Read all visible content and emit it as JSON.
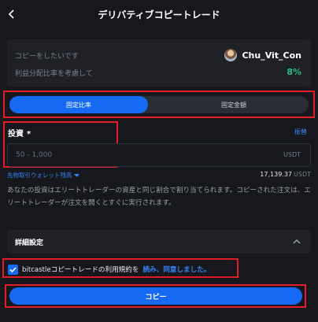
{
  "header": {
    "title": "デリバティブコピートレード",
    "back_icon": "chevron-left-icon"
  },
  "summary": {
    "copy_label": "コピーをしたいです",
    "trader_name": "Chu_Vit_Con",
    "profit_share_label": "利益分配比率を考慮して",
    "profit_share_value": "8%"
  },
  "mode": {
    "ratio_label": "固定比率",
    "amount_label": "固定金額",
    "selected": "ratio"
  },
  "investment": {
    "label": "投資",
    "required_mark": "*",
    "fixed_link": "振替",
    "placeholder": "50 - 1,000",
    "unit": "USDT",
    "wallet_label": "先物取引ウォレット残高",
    "wallet_balance": "17,139.37",
    "wallet_unit": "USDT"
  },
  "description": "あなたの投資はエリートトレーダーの資産と同じ割合で割り当てられます。コピーされた注文は、エリートトレーダーが注文を開くとすぐに実行されます。",
  "advanced": {
    "label": "詳細設定",
    "expanded": true
  },
  "agreement": {
    "checked": true,
    "text": "bitcastleコピートレードの利用規約を",
    "link": "読み、同意しました。"
  },
  "copy_button": {
    "label": "コピー"
  },
  "colors": {
    "accent": "#1669f2",
    "positive": "#2ebd85",
    "link": "#3b82f6",
    "highlight": "#e11d2a"
  }
}
